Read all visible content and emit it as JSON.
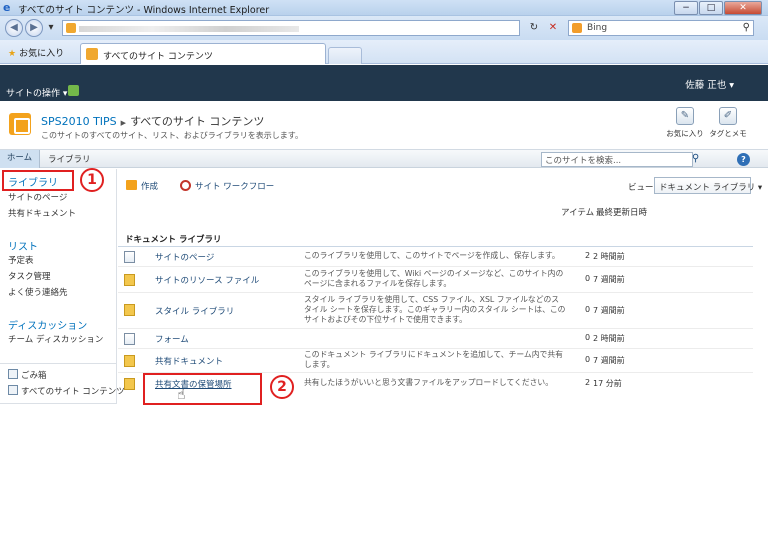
{
  "window": {
    "title": "すべてのサイト コンテンツ - Windows Internet Explorer",
    "ie_icon": "e",
    "min": "−",
    "max": "□",
    "close": "✕"
  },
  "browser": {
    "search_engine": "Bing",
    "favorites_label": "お気に入り",
    "tab_label": "すべてのサイト コンテンツ",
    "back_glyph": "◀",
    "fwd_glyph": "▶",
    "dropdown_glyph": "▾",
    "refresh_glyph": "↻",
    "stop_glyph": "✕",
    "search_glyph": "⚲"
  },
  "sharepoint": {
    "site_actions": "サイトの操作 ▾",
    "user": "佐藤 正也 ▾",
    "site_link": "SPS2010 TIPS",
    "breadcrumb_arrow": "▶",
    "page_title": "すべてのサイト コンテンツ",
    "description": "このサイトのすべてのサイト、リスト、およびライブラリを表示します。",
    "tools": [
      {
        "label": "お気に入り",
        "glyph": "✎"
      },
      {
        "label": "タグとメモ",
        "glyph": "✐"
      }
    ],
    "nav": {
      "home": "ホーム",
      "library": "ライブラリ"
    },
    "search_placeholder": "このサイトを検索...",
    "search_go": "⚲",
    "help": "?"
  },
  "quicklaunch": {
    "libraries_head": "ライブラリ",
    "libraries": [
      "サイトのページ",
      "共有ドキュメント"
    ],
    "lists_head": "リスト",
    "lists": [
      "予定表",
      "タスク管理",
      "よく使う連絡先"
    ],
    "discussions_head": "ディスカッション",
    "discussions": [
      "チーム ディスカッション"
    ],
    "recycle_bin": "ごみ箱",
    "all_site_content": "すべてのサイト コンテンツ"
  },
  "annotations": {
    "one": "1",
    "two": "2"
  },
  "toolbar": {
    "create": "作成",
    "workflow": "サイト ワークフロー",
    "view_label": "ビュー:",
    "view_value": "ドキュメント ライブラリ ▾"
  },
  "list": {
    "col_items": "アイテム",
    "col_modified": "最終更新日時",
    "group": "ドキュメント ライブラリ",
    "rows": [
      {
        "name": "サイトのページ",
        "desc": "このライブラリを使用して、このサイトでページを作成し、保存します。",
        "count": "2",
        "modified": "2 時間前"
      },
      {
        "name": "サイトのリソース ファイル",
        "desc": "このライブラリを使用して、Wiki ページのイメージなど、このサイト内のページに含まれるファイルを保存します。",
        "count": "0",
        "modified": "7 週間前"
      },
      {
        "name": "スタイル ライブラリ",
        "desc": "スタイル ライブラリを使用して、CSS ファイル、XSL ファイルなどのスタイル シートを保存します。このギャラリー内のスタイル シートは、このサイトおよびその下位サイトで使用できます。",
        "count": "0",
        "modified": "7 週間前"
      },
      {
        "name": "フォーム",
        "desc": "",
        "count": "0",
        "modified": "2 時間前"
      },
      {
        "name": "共有ドキュメント",
        "desc": "このドキュメント ライブラリにドキュメントを追加して、チーム内で共有します。",
        "count": "0",
        "modified": "7 週間前"
      },
      {
        "name": "共有文書の保管場所",
        "desc": "共有したほうがいいと思う文書ファイルをアップロードしてください。",
        "count": "2",
        "modified": "17 分前"
      }
    ]
  },
  "colors": {
    "sp_top": "#21374c",
    "link": "#1e4a77",
    "accent": "#0072bc",
    "annotation_red": "#e02020"
  }
}
